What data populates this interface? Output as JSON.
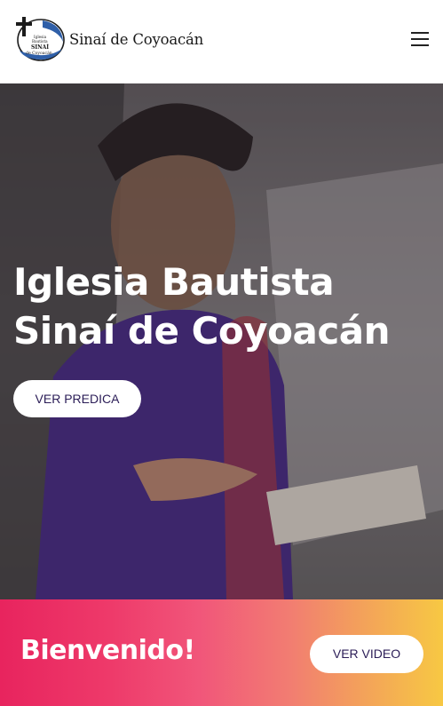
{
  "header": {
    "logo_text": "Sinaí de Coyoacán",
    "logo_emblem_text": [
      "Iglesia",
      "Bautista",
      "SINAÍ",
      "de Coyoacán"
    ]
  },
  "hero": {
    "title_line1": "Iglesia Bautista",
    "title_line2": "Sinaí de Coyoacán",
    "cta_label": "VER PREDICA"
  },
  "welcome": {
    "title": "Bienvenido!",
    "cta_label": "VER VIDEO"
  },
  "colors": {
    "text_dark": "#1a1a1a",
    "button_text": "#2b1d57",
    "gradient_start": "#e8245e",
    "gradient_end": "#f7c843",
    "emblem_blue": "#2f5fa8"
  }
}
